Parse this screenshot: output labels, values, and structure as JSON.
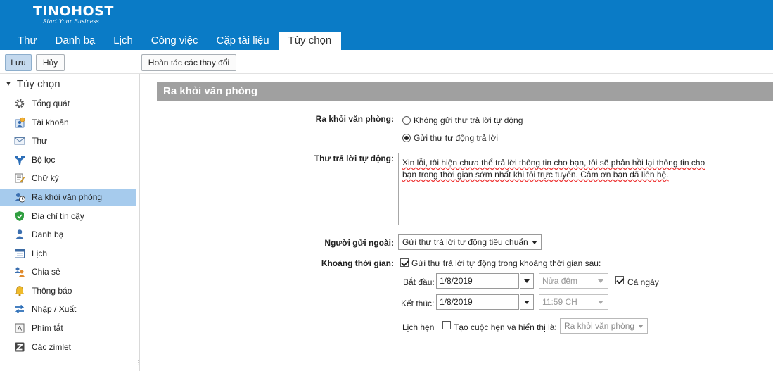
{
  "brand": {
    "name": "TINOHOST",
    "tagline": "Start Your Business"
  },
  "tabs": [
    "Thư",
    "Danh bạ",
    "Lịch",
    "Công việc",
    "Cặp tài liệu",
    "Tùy chọn"
  ],
  "toolbar": {
    "save": "Lưu",
    "cancel": "Hủy",
    "undo": "Hoàn tác các thay đổi"
  },
  "sidebar": {
    "title": "Tùy chọn",
    "items": [
      {
        "label": "Tổng quát",
        "icon": "gear-icon"
      },
      {
        "label": "Tài khoản",
        "icon": "account-icon"
      },
      {
        "label": "Thư",
        "icon": "mail-icon"
      },
      {
        "label": "Bộ lọc",
        "icon": "filter-icon"
      },
      {
        "label": "Chữ ký",
        "icon": "signature-icon"
      },
      {
        "label": "Ra khỏi văn phòng",
        "icon": "out-of-office-icon",
        "selected": true
      },
      {
        "label": "Địa chỉ tin cậy",
        "icon": "shield-icon"
      },
      {
        "label": "Danh bạ",
        "icon": "contacts-icon"
      },
      {
        "label": "Lịch",
        "icon": "calendar-icon"
      },
      {
        "label": "Chia sẻ",
        "icon": "sharing-icon"
      },
      {
        "label": "Thông báo",
        "icon": "bell-icon"
      },
      {
        "label": "Nhập / Xuất",
        "icon": "import-export-icon"
      },
      {
        "label": "Phím tắt",
        "icon": "keyboard-icon"
      },
      {
        "label": "Các zimlet",
        "icon": "zimlet-icon"
      }
    ]
  },
  "panel": {
    "title": "Ra khỏi văn phòng",
    "ooo_label": "Ra khỏi văn phòng:",
    "radio_no": "Không gửi thư trả lời tự động",
    "radio_yes": "Gửi thư tự động trả lời",
    "reply_label": "Thư trả lời tự động:",
    "reply_text": "Xin lỗi, tôi hiện chưa thể trả lời thông tin cho bạn, tôi sẽ phản hồi lại thông tin cho bạn trong thời gian sớm nhất khi tôi trực tuyến. Cảm ơn bạn đã liên hệ.",
    "external_label": "Người gửi ngoài:",
    "external_value": "Gửi thư trả lời tự động tiêu chuẩn",
    "period_label": "Khoảng thời gian:",
    "period_check": "Gửi thư trả lời tự động trong khoảng thời gian sau:",
    "start_label": "Bắt đầu:",
    "start_date": "1/8/2019",
    "start_time": "Nửa đêm",
    "all_day": "Cả ngày",
    "end_label": "Kết thúc:",
    "end_date": "1/8/2019",
    "end_time": "11:59 CH",
    "appt_label": "Lịch hẹn",
    "appt_check": "Tạo cuộc hẹn và hiển thị là:",
    "appt_value": "Ra khỏi văn phòng"
  },
  "colors": {
    "header": "#0a7bc6",
    "selected": "#a6cbed",
    "panel_title": "#a0a0a0"
  }
}
